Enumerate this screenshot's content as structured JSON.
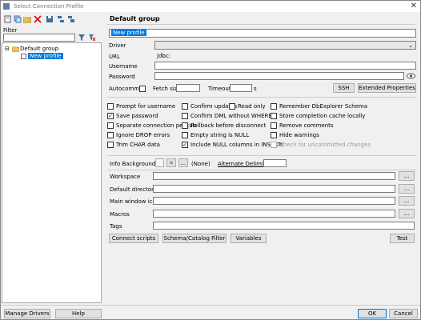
{
  "window": {
    "title": "Select Connection Profile",
    "close_glyph": "✕"
  },
  "left": {
    "filter_label": "Filter",
    "tree": {
      "group": "Default group",
      "profile": "New profile"
    }
  },
  "form": {
    "group_header": "Default group",
    "profile_name": "New profile",
    "driver_label": "Driver",
    "url_label": "URL",
    "url_value": "jdbc:",
    "username_label": "Username",
    "password_label": "Password",
    "autocommit_label": "Autocommit",
    "fetch_size_label": "Fetch size",
    "timeout_label": "Timeout",
    "timeout_unit": "s",
    "ssh_button": "SSH",
    "extended_props_button": "Extended Properties"
  },
  "checkboxes": [
    {
      "label": "Prompt for username",
      "checked": false
    },
    {
      "label": "Confirm updates",
      "checked": false
    },
    {
      "label": "Read only",
      "checked": false
    },
    {
      "label": "Remember DbExplorer Schema",
      "checked": false
    },
    {
      "label": "Save password",
      "checked": true
    },
    {
      "label": "Confirm DML without WHERE",
      "checked": false
    },
    {
      "label": "Store completion cache locally",
      "checked": false
    },
    {
      "label": "Separate connection per tab",
      "checked": false
    },
    {
      "label": "Rollback before disconnect",
      "checked": false
    },
    {
      "label": "Remove comments",
      "checked": false
    },
    {
      "label": "Ignore DROP errors",
      "checked": false
    },
    {
      "label": "Empty string is NULL",
      "checked": false
    },
    {
      "label": "Hide warnings",
      "checked": false
    },
    {
      "label": "Trim CHAR data",
      "checked": false
    },
    {
      "label": "Include NULL columns in INSERTs",
      "checked": true
    },
    {
      "label": "Check for uncommitted changes",
      "checked": false
    }
  ],
  "info": {
    "info_bg_label": "Info Background",
    "none_label": "(None)",
    "alternate_delimiter": "Alternate Delimiter",
    "ellipsis": "...",
    "x_glyph": "✕"
  },
  "fields": {
    "workspace": "Workspace",
    "default_directory": "Default directory",
    "main_window_icon": "Main window icon",
    "macros": "Macros",
    "tags": "Tags"
  },
  "actions": {
    "connect_scripts": "Connect scripts",
    "schema_filter": "Schema/Catalog Filter",
    "variables": "Variables",
    "test": "Test"
  },
  "bottom": {
    "manage_drivers": "Manage Drivers",
    "help": "Help",
    "ok": "OK",
    "cancel": "Cancel"
  }
}
